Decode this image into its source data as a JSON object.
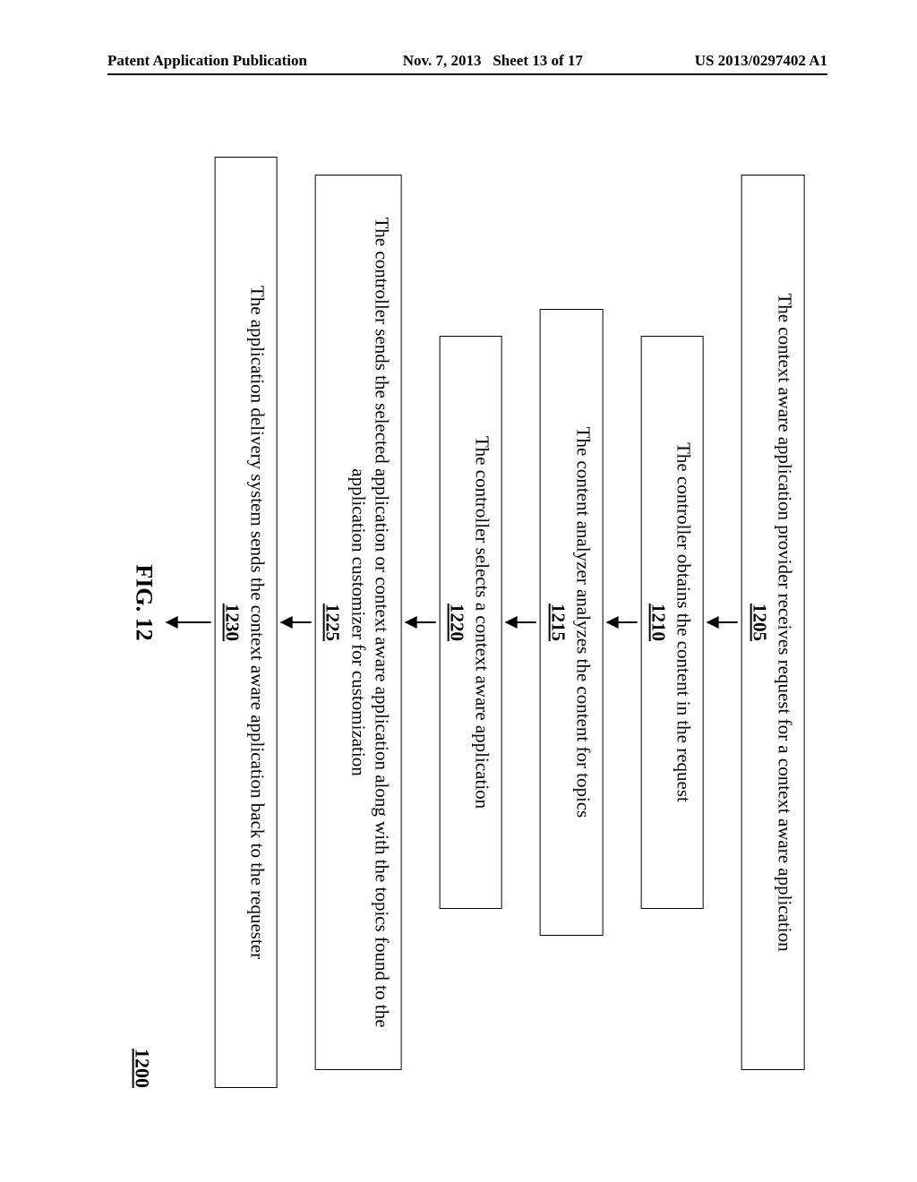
{
  "header": {
    "left": "Patent Application Publication",
    "date": "Nov. 7, 2013",
    "sheet": "Sheet 13 of 17",
    "pubno": "US 2013/0297402 A1"
  },
  "flow": {
    "steps": [
      {
        "text": "The context aware application provider receives request for a context aware application",
        "ref": "1205"
      },
      {
        "text": "The controller obtains the content in the request",
        "ref": "1210"
      },
      {
        "text": "The content analyzer analyzes the content for topics",
        "ref": "1215"
      },
      {
        "text": "The controller selects a context aware application",
        "ref": "1220"
      },
      {
        "text": "The controller sends the selected application or context aware application along with the topics found to the application customizer for customization",
        "ref": "1225"
      },
      {
        "text": "The application delivery system sends the context aware application back to the requester",
        "ref": "1230"
      }
    ],
    "page_ref": "1200",
    "caption": "FIG. 12"
  }
}
